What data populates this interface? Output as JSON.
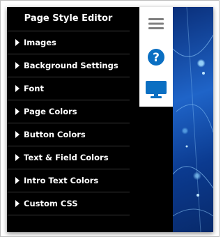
{
  "editor": {
    "title": "Page Style Editor",
    "menu": [
      {
        "label": "Images"
      },
      {
        "label": "Background Settings"
      },
      {
        "label": "Font"
      },
      {
        "label": "Page Colors"
      },
      {
        "label": "Button Colors"
      },
      {
        "label": "Text & Field Colors"
      },
      {
        "label": "Intro Text Colors"
      },
      {
        "label": "Custom CSS"
      }
    ]
  },
  "toolbar": {
    "icons": [
      "hamburger-menu-icon",
      "help-icon",
      "desktop-preview-icon"
    ]
  },
  "colors": {
    "panel_bg": "#000000",
    "accent_blue": "#0b6fc2",
    "icon_gray": "#808080"
  }
}
